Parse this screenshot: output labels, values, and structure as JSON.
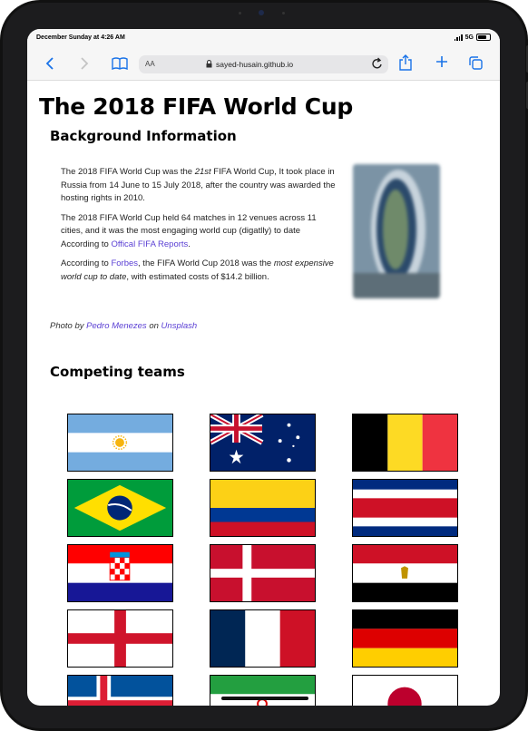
{
  "status": {
    "time": "December Sunday at 4:26 AM",
    "network": "5G"
  },
  "browser": {
    "aa_label": "AA",
    "url": "sayed-husain.github.io"
  },
  "page": {
    "title": "The 2018 FIFA World Cup",
    "background_heading": "Background Information",
    "para1_a": "The 2018 FIFA World Cup was the ",
    "para1_em": "21st",
    "para1_b": " FIFA World Cup, It took place in Russia from 14 June to 15 July 2018, after the country was awarded the hosting rights in 2010.",
    "para2_a": "The 2018 FIFA World Cup held 64 matches in 12 venues across 11 cities, and it was the most engaging world cup (digatlly) to date According to ",
    "para2_link": "Offical FIFA Reports",
    "para2_b": ".",
    "para3_a": "According to ",
    "para3_link": "Forbes",
    "para3_b": ", the FIFA World Cup 2018 was the ",
    "para3_em": "most expensive world cup to date",
    "para3_c": ", with estimated costs of $14.2 billion.",
    "credit_a": "Photo by ",
    "credit_link1": "Pedro Menezes",
    "credit_b": " on ",
    "credit_link2": "Unsplash",
    "teams_heading": "Competing teams"
  },
  "flags": [
    "Argentina",
    "Australia",
    "Belgium",
    "Brazil",
    "Colombia",
    "Costa Rica",
    "Croatia",
    "Denmark",
    "Egypt",
    "England",
    "France",
    "Germany",
    "Iceland",
    "Iran",
    "Japan"
  ],
  "colors": {
    "link": "#5a3fd4",
    "accent": "#1a73e8"
  }
}
